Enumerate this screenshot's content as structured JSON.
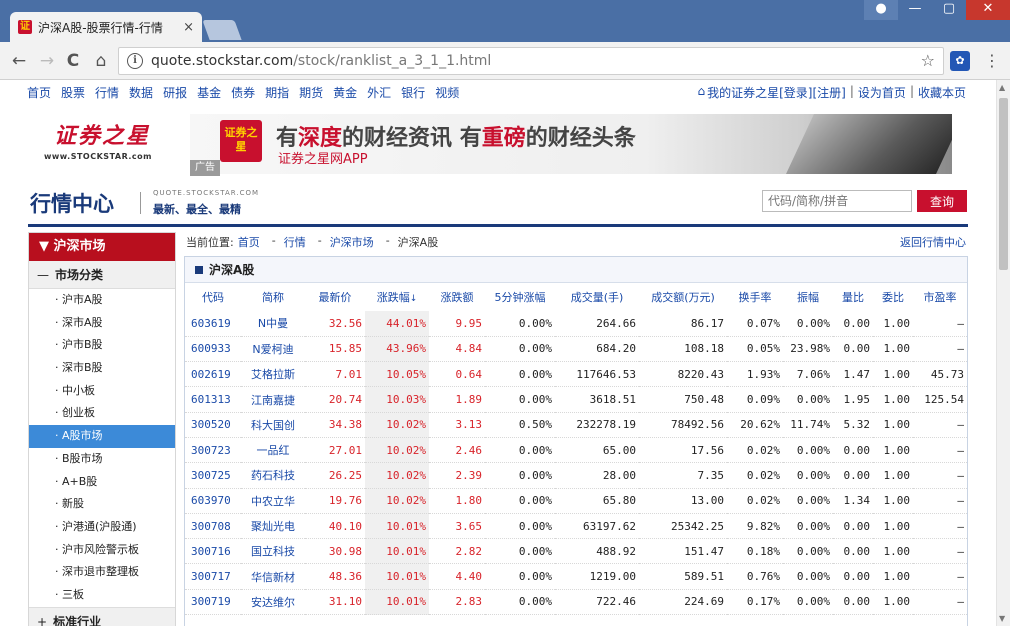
{
  "browser": {
    "tab_title": "沪深A股-股票行情-行情",
    "tab_favicon": "证",
    "tab_close": "×",
    "url_host": "quote.stockstar.com",
    "url_path": "/stock/ranklist_a_3_1_1.html",
    "icons": {
      "back": "←",
      "forward": "→",
      "reload": "C",
      "home": "⌂",
      "star": "☆",
      "menu": "⋮",
      "info": "i"
    }
  },
  "site": {
    "topnav": [
      "首页",
      "股票",
      "行情",
      "数据",
      "研报",
      "基金",
      "债券",
      "期指",
      "期货",
      "黄金",
      "外汇",
      "银行",
      "视频"
    ],
    "topnav_right": [
      "我的证券之星",
      "[登录]",
      "[注册]",
      "|",
      "设为首页",
      "|",
      "收藏本页"
    ],
    "logo_cn": "证券之星",
    "logo_en": "www.STOCKSTAR.com",
    "banner": {
      "seal": "证券之星",
      "headline_1": "有",
      "headline_2": "深度",
      "headline_3": "的财经资讯  有",
      "headline_4": "重磅",
      "headline_5": "的财经头条",
      "sub": "证券之星网APP",
      "ad_tag": "广告"
    },
    "center_title": "行情中心",
    "center_domain": "QUOTE.STOCKSTAR.COM",
    "center_slogan": "最新、最全、最精",
    "search_placeholder": "代码/简称/拼音",
    "search_button": "查询"
  },
  "sidebar": {
    "head": "沪深市场",
    "group1": "市场分类",
    "group1_sign": "—",
    "items": [
      "沪市A股",
      "深市A股",
      "沪市B股",
      "深市B股",
      "中小板",
      "创业板",
      "A股市场",
      "B股市场",
      "A+B股",
      "新股",
      "沪港通(沪股通)",
      "沪市风险警示板",
      "深市退市整理板",
      "三板"
    ],
    "active_index": 6,
    "group2": "标准行业",
    "group2_sign": "+"
  },
  "breadcrumb": {
    "label": "当前位置:",
    "parts": [
      "首页",
      "行情",
      "沪深市场",
      "沪深A股"
    ],
    "back": "返回行情中心"
  },
  "table": {
    "title": "沪深A股",
    "columns": [
      "代码",
      "简称",
      "最新价",
      "涨跌幅",
      "涨跌额",
      "5分钟涨幅",
      "成交量(手)",
      "成交额(万元)",
      "换手率",
      "振幅",
      "量比",
      "委比",
      "市盈率"
    ],
    "sort_arrow": "↓",
    "rows": [
      [
        "603619",
        "N中曼",
        "32.56",
        "44.01%",
        "9.95",
        "0.00%",
        "264.66",
        "86.17",
        "0.07%",
        "0.00%",
        "0.00",
        "1.00",
        "—"
      ],
      [
        "600933",
        "N爱柯迪",
        "15.85",
        "43.96%",
        "4.84",
        "0.00%",
        "684.20",
        "108.18",
        "0.05%",
        "23.98%",
        "0.00",
        "1.00",
        "—"
      ],
      [
        "002619",
        "艾格拉斯",
        "7.01",
        "10.05%",
        "0.64",
        "0.00%",
        "117646.53",
        "8220.43",
        "1.93%",
        "7.06%",
        "1.47",
        "1.00",
        "45.73"
      ],
      [
        "601313",
        "江南嘉捷",
        "20.74",
        "10.03%",
        "1.89",
        "0.00%",
        "3618.51",
        "750.48",
        "0.09%",
        "0.00%",
        "1.95",
        "1.00",
        "125.54"
      ],
      [
        "300520",
        "科大国创",
        "34.38",
        "10.02%",
        "3.13",
        "0.50%",
        "232278.19",
        "78492.56",
        "20.62%",
        "11.74%",
        "5.32",
        "1.00",
        "—"
      ],
      [
        "300723",
        "一品红",
        "27.01",
        "10.02%",
        "2.46",
        "0.00%",
        "65.00",
        "17.56",
        "0.02%",
        "0.00%",
        "0.00",
        "1.00",
        "—"
      ],
      [
        "300725",
        "药石科技",
        "26.25",
        "10.02%",
        "2.39",
        "0.00%",
        "28.00",
        "7.35",
        "0.02%",
        "0.00%",
        "0.00",
        "1.00",
        "—"
      ],
      [
        "603970",
        "中农立华",
        "19.76",
        "10.02%",
        "1.80",
        "0.00%",
        "65.80",
        "13.00",
        "0.02%",
        "0.00%",
        "1.34",
        "1.00",
        "—"
      ],
      [
        "300708",
        "聚灿光电",
        "40.10",
        "10.01%",
        "3.65",
        "0.00%",
        "63197.62",
        "25342.25",
        "9.82%",
        "0.00%",
        "0.00",
        "1.00",
        "—"
      ],
      [
        "300716",
        "国立科技",
        "30.98",
        "10.01%",
        "2.82",
        "0.00%",
        "488.92",
        "151.47",
        "0.18%",
        "0.00%",
        "0.00",
        "1.00",
        "—"
      ],
      [
        "300717",
        "华信新材",
        "48.36",
        "10.01%",
        "4.40",
        "0.00%",
        "1219.00",
        "589.51",
        "0.76%",
        "0.00%",
        "0.00",
        "1.00",
        "—"
      ],
      [
        "300719",
        "安达维尔",
        "31.10",
        "10.01%",
        "2.83",
        "0.00%",
        "722.46",
        "224.69",
        "0.17%",
        "0.00%",
        "0.00",
        "1.00",
        "—"
      ]
    ]
  },
  "colors": {
    "brand_red": "#c8102e",
    "link_blue": "#1a4aa8",
    "up_red": "#d8232a",
    "active_blue": "#3c8ad8",
    "navy": "#1a3a7a"
  }
}
